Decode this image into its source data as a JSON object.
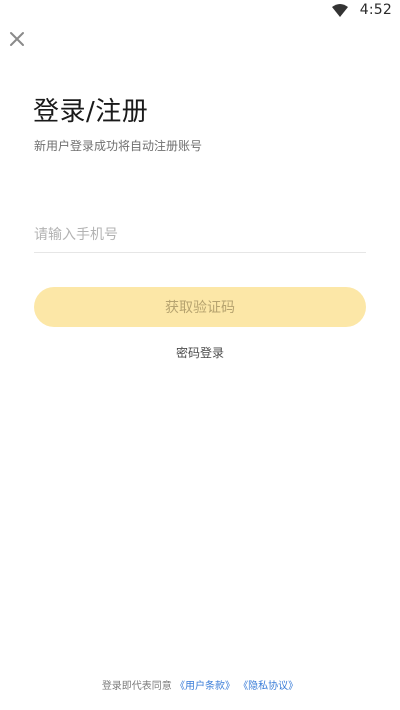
{
  "status_bar": {
    "time": "4:52",
    "wifi_icon": "wifi-icon"
  },
  "close_icon": "close-icon",
  "title": "登录/注册",
  "subtitle": "新用户登录成功将自动注册账号",
  "phone_input": {
    "placeholder": "请输入手机号",
    "value": ""
  },
  "get_code_label": "获取验证码",
  "password_login_label": "密码登录",
  "agreement": {
    "prefix": "登录即代表同意",
    "terms_link": "《用户条款》",
    "privacy_link": "《隐私协议》"
  },
  "colors": {
    "accent_button_bg": "#fce7a7",
    "accent_button_text": "#b6a36f",
    "link": "#3a7dd8"
  }
}
